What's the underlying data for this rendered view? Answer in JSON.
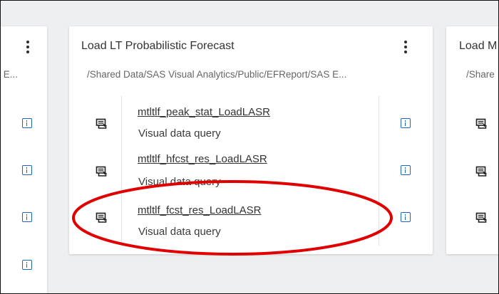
{
  "cards": {
    "left": {
      "path_fragment": "S E..."
    },
    "main": {
      "title": "Load LT Probabilistic Forecast",
      "path": "/Shared Data/SAS Visual Analytics/Public/EFReport/SAS E...",
      "items": [
        {
          "name": "mtltlf_peak_stat_LoadLASR",
          "type": "Visual data query"
        },
        {
          "name": "mtltlf_hfcst_res_LoadLASR",
          "type": "Visual data query"
        },
        {
          "name": "mtltlf_fcst_res_LoadLASR",
          "type": "Visual data query"
        }
      ]
    },
    "right": {
      "title_fragment": "Load M",
      "path_fragment": "/Share"
    }
  },
  "icons": {
    "kebab": "more-vertical-icon",
    "info": "info-icon",
    "query": "visual-data-query-icon"
  },
  "colors": {
    "accent_blue": "#1f66c2",
    "highlight_red": "#e00000",
    "canvas": "#eeeff1",
    "card": "#ffffff"
  }
}
